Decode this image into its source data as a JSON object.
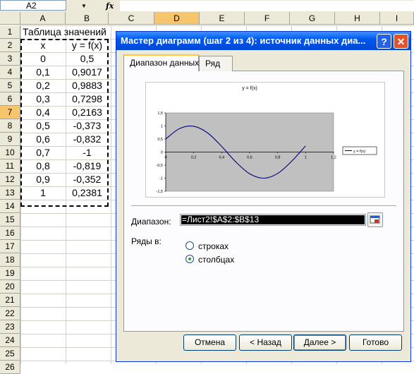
{
  "formula_bar": {
    "name_box": "A2",
    "fx": "fx"
  },
  "columns": [
    "A",
    "B",
    "C",
    "D",
    "E",
    "F",
    "G",
    "H",
    "I"
  ],
  "rows": [
    "1",
    "2",
    "3",
    "4",
    "5",
    "6",
    "7",
    "8",
    "9",
    "10",
    "11",
    "12",
    "13",
    "14",
    "15",
    "16",
    "17",
    "18",
    "19",
    "20",
    "21",
    "22",
    "23",
    "24",
    "25",
    "26"
  ],
  "sheet": {
    "title": "Таблица значений",
    "header_x": "x",
    "header_y": "y = f(x)",
    "x_values": [
      "0",
      "0,1",
      "0,2",
      "0,3",
      "0,4",
      "0,5",
      "0,6",
      "0,7",
      "0,8",
      "0,9",
      "1"
    ],
    "y_values": [
      "0,5",
      "0,9017",
      "0,9883",
      "0,7298",
      "0,2163",
      "-0,373",
      "-0,832",
      "-1",
      "-0,819",
      "-0,352",
      "0,2381"
    ]
  },
  "dialog": {
    "title": "Мастер диаграмм (шаг 2 из 4): источник данных диа...",
    "help": "?",
    "close": "✕",
    "tabs": [
      "Диапазон данных",
      "Ряд"
    ],
    "range_label": "Диапазон:",
    "range_value": "=Лист2!$A$2:$B$13",
    "series_in_label": "Ряды в:",
    "radio_rows": "строках",
    "radio_cols": "столбцах",
    "buttons": {
      "cancel": "Отмена",
      "back": "< Назад",
      "next": "Далее >",
      "finish": "Готово"
    }
  },
  "chart_data": {
    "type": "line",
    "title": "y = f(x)",
    "legend": "y = f(x)",
    "legend_position": "right",
    "x": [
      0,
      0.1,
      0.2,
      0.3,
      0.4,
      0.5,
      0.6,
      0.7,
      0.8,
      0.9,
      1
    ],
    "series": [
      {
        "name": "y = f(x)",
        "values": [
          0.5,
          0.9017,
          0.9883,
          0.7298,
          0.2163,
          -0.373,
          -0.832,
          -1,
          -0.819,
          -0.352,
          0.2381
        ]
      }
    ],
    "xlim": [
      0,
      1.2
    ],
    "ylim": [
      -1.5,
      1.5
    ],
    "x_ticks": [
      "0",
      "0,2",
      "0,4",
      "0,6",
      "0,8",
      "1",
      "1,2"
    ],
    "y_ticks": [
      "1,5",
      "1",
      "0,5",
      "0",
      "-0,5",
      "-1",
      "-1,5"
    ],
    "plot_background": "#c0c0c0",
    "line_color": "#000080"
  }
}
